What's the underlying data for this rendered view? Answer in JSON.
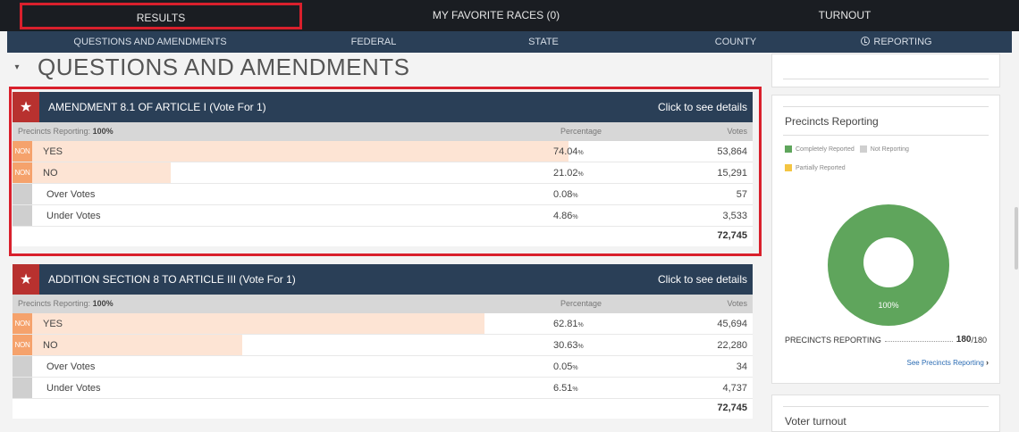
{
  "topnav": {
    "results": "RESULTS",
    "favorites": "MY FAVORITE RACES (0)",
    "turnout": "TURNOUT"
  },
  "subnav": {
    "questions": "QUESTIONS AND AMENDMENTS",
    "federal": "FEDERAL",
    "state": "STATE",
    "county": "COUNTY",
    "reporting": "REPORTING"
  },
  "section": {
    "caret": "▾",
    "title": "QUESTIONS AND AMENDMENTS"
  },
  "races": [
    {
      "name": "AMENDMENT 8.1 OF ARTICLE I (Vote For 1)",
      "details": "Click to see details",
      "precincts_label": "Precincts Reporting:",
      "precincts_value": "100%",
      "pct_header": "Percentage",
      "votes_header": "Votes",
      "rows": [
        {
          "badge": "NON",
          "label": "YES",
          "pct": "74.04",
          "votes": "53,864",
          "share": 0.7404
        },
        {
          "badge": "NON",
          "label": "NO",
          "pct": "21.02",
          "votes": "15,291",
          "share": 0.2102
        },
        {
          "badge": "",
          "label": "Over Votes",
          "pct": "0.08",
          "votes": "57",
          "share": 0
        },
        {
          "badge": "",
          "label": "Under Votes",
          "pct": "4.86",
          "votes": "3,533",
          "share": 0
        }
      ],
      "total": "72,745"
    },
    {
      "name": "ADDITION SECTION 8 TO ARTICLE III (Vote For 1)",
      "details": "Click to see details",
      "precincts_label": "Precincts Reporting:",
      "precincts_value": "100%",
      "pct_header": "Percentage",
      "votes_header": "Votes",
      "rows": [
        {
          "badge": "NON",
          "label": "YES",
          "pct": "62.81",
          "votes": "45,694",
          "share": 0.6281
        },
        {
          "badge": "NON",
          "label": "NO",
          "pct": "30.63",
          "votes": "22,280",
          "share": 0.3063
        },
        {
          "badge": "",
          "label": "Over Votes",
          "pct": "0.05",
          "votes": "34",
          "share": 0
        },
        {
          "badge": "",
          "label": "Under Votes",
          "pct": "6.51",
          "votes": "4,737",
          "share": 0
        }
      ],
      "total": "72,745"
    }
  ],
  "pct_symbol": "%",
  "sidebar": {
    "precincts_title": "Precincts Reporting",
    "legend": {
      "complete": "Completely Reported",
      "not": "Not Reporting",
      "partial": "Partially Reported"
    },
    "colors": {
      "complete": "#5fa55c",
      "not": "#cfcfcf",
      "partial": "#f4c542"
    },
    "donut_label": "100%",
    "reporting_label": "PRECINCTS REPORTING",
    "reporting_count": "180",
    "reporting_total": "/180",
    "see_link": "See Precincts Reporting",
    "turnout_title": "Voter turnout"
  }
}
